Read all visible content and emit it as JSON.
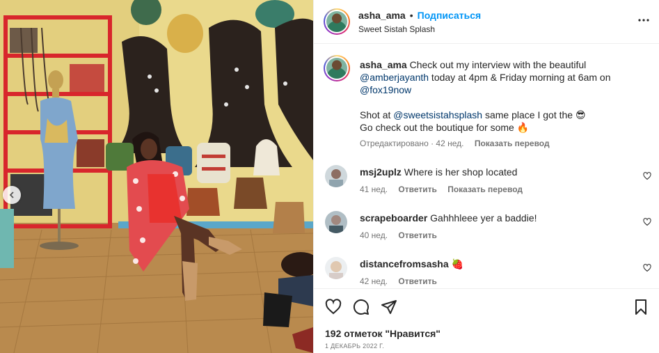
{
  "post": {
    "username": "asha_ama",
    "separator": "•",
    "follow_label": "Подписаться",
    "subtitle": "Sweet Sistah Splash",
    "more_icon": "more-horizontal-icon"
  },
  "caption": {
    "username": "asha_ama",
    "text_1": " Check out my interview with the beautiful ",
    "mention_1": "@amberjayanth",
    "text_2": " today at 4pm & Friday morning at 6am on ",
    "mention_2": "@fox19now",
    "text_3": "Shot at ",
    "mention_3": "@sweetsistahsplash",
    "text_4": " same place I got the 😎",
    "text_5": "Go check out the boutique for some 🔥",
    "edited": "Отредактировано · 42 нед.",
    "translate": "Показать перевод"
  },
  "comments": [
    {
      "username": "msj2uplz",
      "text": " Where is her shop located",
      "age": "41 нед.",
      "reply": "Ответить",
      "translate": "Показать перевод"
    },
    {
      "username": "scrapeboarder",
      "text": " Gahhhleee yer a baddie!",
      "age": "40 нед.",
      "reply": "Ответить"
    },
    {
      "username": "distancefromsasha",
      "text": " 🍓",
      "age": "42 нед.",
      "reply": "Ответить"
    }
  ],
  "actions": {
    "like_icon": "heart-icon",
    "comment_icon": "comment-icon",
    "share_icon": "send-icon",
    "save_icon": "bookmark-icon"
  },
  "likes": "192 отметок \"Нравится\"",
  "date": "1 ДЕКАБРЬ 2022 Г."
}
